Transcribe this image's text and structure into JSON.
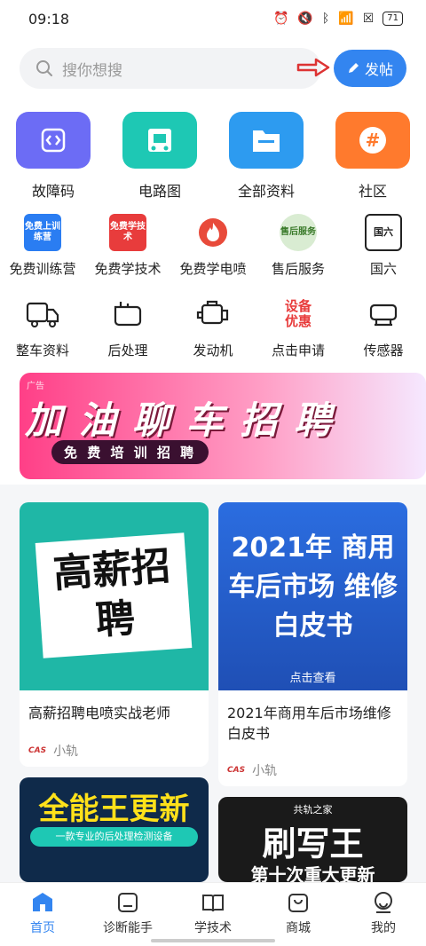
{
  "status": {
    "time": "09:18",
    "battery": "71"
  },
  "search": {
    "placeholder": "搜你想搜"
  },
  "post_button": {
    "label": "发帖"
  },
  "grid_main": [
    {
      "label": "故障码",
      "color": "#6c6cf5",
      "icon": "code-icon"
    },
    {
      "label": "电路图",
      "color": "#1ec8b4",
      "icon": "circuit-icon"
    },
    {
      "label": "全部资料",
      "color": "#2d9bf0",
      "icon": "folder-icon"
    },
    {
      "label": "社区",
      "color": "#ff7a2d",
      "icon": "hash-icon"
    }
  ],
  "grid_row2": [
    {
      "label": "免费训练营",
      "tile": "免费上训练营",
      "color": "#2a7df2"
    },
    {
      "label": "免费学技术",
      "tile": "免费学技术",
      "color": "#e83c3c"
    },
    {
      "label": "免费学电喷",
      "icon": "flame-icon",
      "color": "#e84a3a"
    },
    {
      "label": "售后服务",
      "tile": "售后服务",
      "color": "#d9ecd2"
    },
    {
      "label": "国六",
      "tile": "国六",
      "color": "#ffffff"
    }
  ],
  "grid_row3": [
    {
      "label": "整车资料",
      "icon": "truck-icon"
    },
    {
      "label": "后处理",
      "icon": "aftertreatment-icon"
    },
    {
      "label": "发动机",
      "icon": "engine-icon"
    },
    {
      "label": "点击申请",
      "tile": "设备优惠",
      "color": "#e83c3c"
    },
    {
      "label": "传感器",
      "icon": "sensor-icon"
    }
  ],
  "banner": {
    "tag": "广告",
    "title": "加 油 聊 车 招 聘",
    "subtitle": "免 费 培 训 招 聘"
  },
  "cards": [
    {
      "image_text": "高薪招聘",
      "title": "高薪招聘电喷实战老师",
      "author": "小轨"
    },
    {
      "image_text": "2021年 商用车后市场 维修白皮书",
      "image_caption": "点击查看",
      "title": "2021年商用车后市场维修白皮书",
      "author": "小轨"
    },
    {
      "image_text": "全能王更新",
      "image_sub": "一款专业的后处理检测设备"
    },
    {
      "image_brand": "共轨之家",
      "image_text": "刷写王",
      "image_sub": "第十次重大更新"
    }
  ],
  "tabs": [
    {
      "label": "首页",
      "icon": "home-icon",
      "active": true
    },
    {
      "label": "诊断能手",
      "icon": "diagnosis-icon"
    },
    {
      "label": "学技术",
      "icon": "book-icon"
    },
    {
      "label": "商城",
      "icon": "shop-icon"
    },
    {
      "label": "我的",
      "icon": "profile-icon"
    }
  ]
}
